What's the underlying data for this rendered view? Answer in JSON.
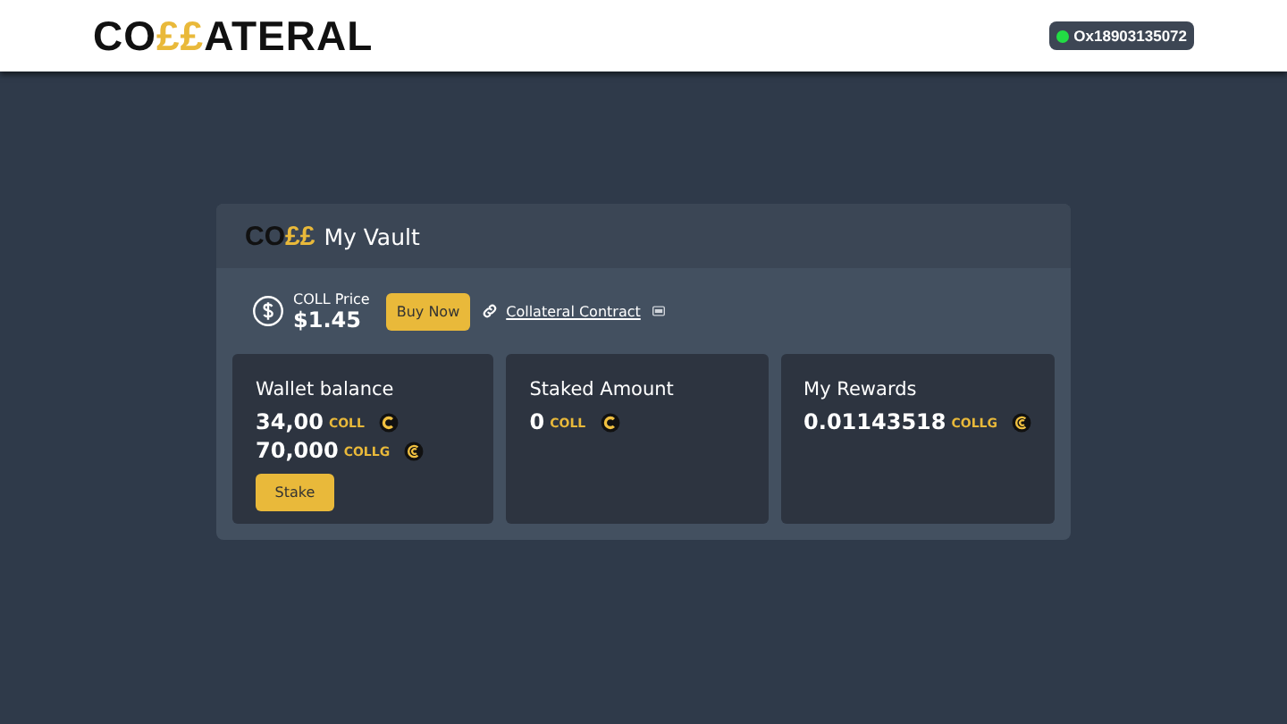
{
  "header": {
    "logo": {
      "start": "CO",
      "accent": "££",
      "end": "ATERAL"
    },
    "wallet": {
      "connected": true,
      "address": "Ox18903135072"
    }
  },
  "vault": {
    "logo": {
      "start": "CO",
      "accent": "££"
    },
    "title": "My Vault",
    "price": {
      "label": "COLL Price",
      "value": "$1.45"
    },
    "buy_button": "Buy Now",
    "contract_link": "Collateral Contract",
    "cards": [
      {
        "title": "Wallet balance",
        "amounts": [
          {
            "value": "34,00",
            "unit": "COLL",
            "kind": "coll"
          },
          {
            "value": "70,000",
            "unit": "COLLG",
            "kind": "collg"
          }
        ],
        "button": "Stake"
      },
      {
        "title": "Staked Amount",
        "amounts": [
          {
            "value": "0",
            "unit": "COLL",
            "kind": "coll"
          }
        ]
      },
      {
        "title": "My Rewards",
        "amounts": [
          {
            "value": "0.01143518",
            "unit": "COLLG",
            "kind": "collg"
          }
        ]
      }
    ]
  }
}
